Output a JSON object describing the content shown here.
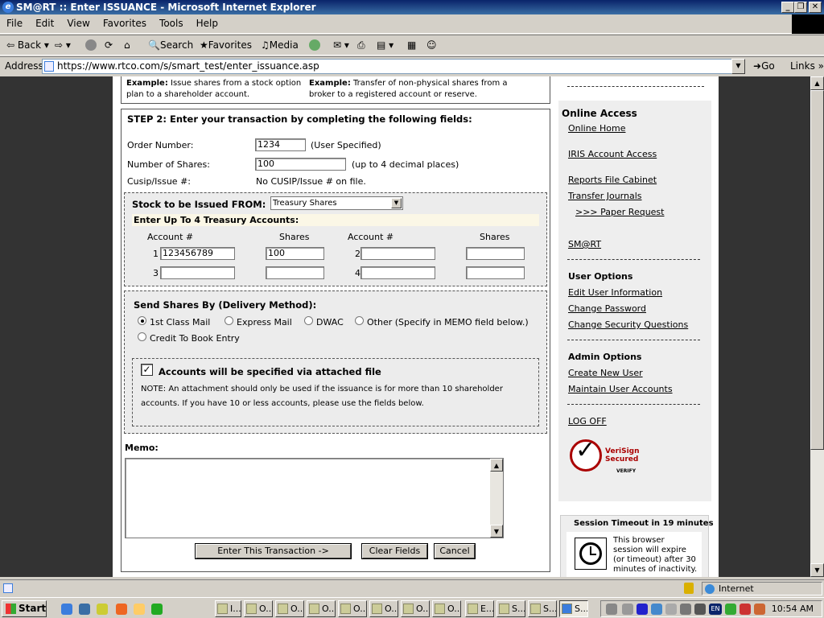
{
  "window": {
    "title": "SM@RT :: Enter ISSUANCE - Microsoft Internet Explorer"
  },
  "menu": [
    "File",
    "Edit",
    "View",
    "Favorites",
    "Tools",
    "Help"
  ],
  "toolbar": {
    "back": "Back",
    "search": "Search",
    "favorites": "Favorites",
    "media": "Media"
  },
  "address": {
    "label": "Address",
    "url": "https://www.rtco.com/s/smart_test/enter_issuance.asp",
    "go": "Go",
    "links": "Links"
  },
  "examples": {
    "left_label": "Example:",
    "left_text": "Issue shares from a stock option",
    "left_text2": "plan to a shareholder account.",
    "right_label": "Example:",
    "right_text": "Transfer of non-physical shares from a",
    "right_text2": "broker to a registered account or reserve."
  },
  "step2": {
    "title": "STEP 2: Enter your transaction by completing the following fields:",
    "order_label": "Order Number:",
    "order_value": "1234",
    "order_hint": "(User Specified)",
    "shares_label": "Number of Shares:",
    "shares_value": "100",
    "shares_hint": "(up to 4 decimal places)",
    "cusip_label": "Cusip/Issue #:",
    "cusip_value": "No CUSIP/Issue # on file."
  },
  "issued_from": {
    "label": "Stock to be Issued FROM:",
    "selected": "Treasury Shares",
    "subheading": "Enter Up To 4 Treasury Accounts:",
    "col_account": "Account #",
    "col_shares": "Shares",
    "rows": [
      {
        "n1": "1",
        "acct1": "123456789",
        "shares1": "100",
        "n2": "2",
        "acct2": "",
        "shares2": ""
      },
      {
        "n1": "3",
        "acct1": "",
        "shares1": "",
        "n2": "4",
        "acct2": "",
        "shares2": ""
      }
    ]
  },
  "delivery": {
    "title": "Send Shares By (Delivery Method):",
    "options": [
      "1st Class Mail",
      "Express Mail",
      "DWAC",
      "Other (Specify in MEMO field below.)",
      "Credit To Book Entry"
    ],
    "selected": "1st Class Mail"
  },
  "attach": {
    "label": "Accounts will be specified via attached file",
    "checked": true,
    "note1": "NOTE: An attachment should only be used if the issuance is for more than 10 shareholder",
    "note2": "accounts. If you have 10 or less accounts, please use the fields below."
  },
  "memo": {
    "label": "Memo:",
    "value": ""
  },
  "buttons": {
    "enter": "Enter This Transaction ->",
    "clear": "Clear Fields",
    "cancel": "Cancel"
  },
  "sidebar": {
    "online_access": "Online Access",
    "links1": [
      "Online Home",
      "IRIS Account Access",
      "Reports File Cabinet",
      "Transfer Journals"
    ],
    "paper_request": ">>> Paper Request",
    "smart": "SM@RT",
    "user_options": "User Options",
    "user_links": [
      "Edit User Information",
      "Change Password",
      "Change Security Questions"
    ],
    "admin_options": "Admin Options",
    "admin_links": [
      "Create New User",
      "Maintain User Accounts"
    ],
    "logoff": "LOG OFF",
    "verisign_line1": "VeriSign",
    "verisign_line2": "Secured",
    "verisign_verify": "VERIFY",
    "session_title": "Session Timeout in 19 minutes",
    "session_text": [
      "This browser",
      "session will expire",
      "(or timeout) after 30",
      "minutes of inactivity."
    ]
  },
  "status": {
    "zone": "Internet"
  },
  "taskbar": {
    "start": "Start",
    "tasks": [
      "I...",
      "O...",
      "O...",
      "O...",
      "O...",
      "O...",
      "O...",
      "O...",
      "E...",
      "S...",
      "S...",
      "S..."
    ],
    "clock": "10:54 AM",
    "lang": "EN"
  }
}
